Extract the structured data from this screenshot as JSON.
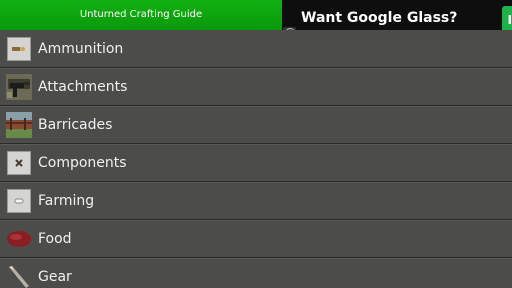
{
  "header": {
    "title": "Unturned Crafting Guide"
  },
  "ad": {
    "headline": "Want Google Glass?",
    "info_glyph": "i",
    "button_glyph": "I"
  },
  "categories": [
    {
      "label": "Ammunition",
      "icon": "ammunition-icon"
    },
    {
      "label": "Attachments",
      "icon": "attachments-icon"
    },
    {
      "label": "Barricades",
      "icon": "barricades-icon"
    },
    {
      "label": "Components",
      "icon": "components-icon"
    },
    {
      "label": "Farming",
      "icon": "farming-icon"
    },
    {
      "label": "Food",
      "icon": "food-icon"
    },
    {
      "label": "Gear",
      "icon": "gear-icon"
    }
  ],
  "colors": {
    "title_bar": "#0fa60f",
    "ad_background": "#0e0e0e",
    "list_background": "#4c4c4a"
  }
}
